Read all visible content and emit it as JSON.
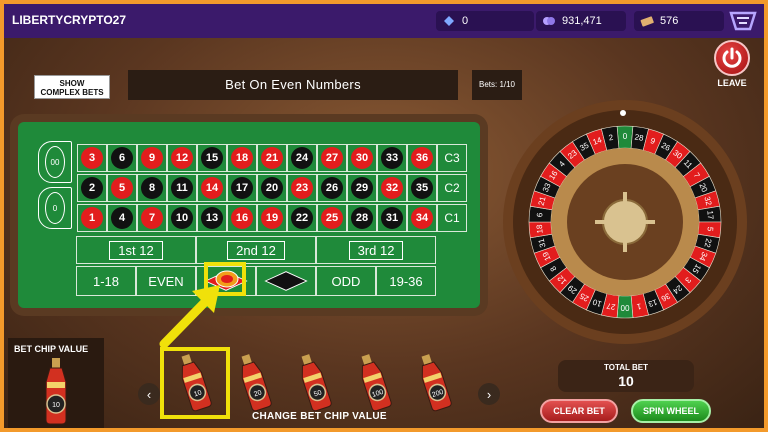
{
  "topbar": {
    "username": "LIBERTYCRYPTO27",
    "gems": "0",
    "coins": "931,471",
    "tickets": "576"
  },
  "controls": {
    "show_complex_label": "SHOW\nCOMPLEX BETS",
    "bet_title": "Bet On Even Numbers",
    "bets_count": "Bets: 1/10",
    "leave_label": "LEAVE"
  },
  "board": {
    "zeros": [
      "00",
      "0"
    ],
    "rows": [
      [
        {
          "n": "3",
          "c": "red"
        },
        {
          "n": "6",
          "c": "black"
        },
        {
          "n": "9",
          "c": "red"
        },
        {
          "n": "12",
          "c": "red"
        },
        {
          "n": "15",
          "c": "black"
        },
        {
          "n": "18",
          "c": "red"
        },
        {
          "n": "21",
          "c": "red"
        },
        {
          "n": "24",
          "c": "black"
        },
        {
          "n": "27",
          "c": "red"
        },
        {
          "n": "30",
          "c": "red"
        },
        {
          "n": "33",
          "c": "black"
        },
        {
          "n": "36",
          "c": "red"
        }
      ],
      [
        {
          "n": "2",
          "c": "black"
        },
        {
          "n": "5",
          "c": "red"
        },
        {
          "n": "8",
          "c": "black"
        },
        {
          "n": "11",
          "c": "black"
        },
        {
          "n": "14",
          "c": "red"
        },
        {
          "n": "17",
          "c": "black"
        },
        {
          "n": "20",
          "c": "black"
        },
        {
          "n": "23",
          "c": "red"
        },
        {
          "n": "26",
          "c": "black"
        },
        {
          "n": "29",
          "c": "black"
        },
        {
          "n": "32",
          "c": "red"
        },
        {
          "n": "35",
          "c": "black"
        }
      ],
      [
        {
          "n": "1",
          "c": "red"
        },
        {
          "n": "4",
          "c": "black"
        },
        {
          "n": "7",
          "c": "red"
        },
        {
          "n": "10",
          "c": "black"
        },
        {
          "n": "13",
          "c": "black"
        },
        {
          "n": "16",
          "c": "red"
        },
        {
          "n": "19",
          "c": "red"
        },
        {
          "n": "22",
          "c": "black"
        },
        {
          "n": "25",
          "c": "red"
        },
        {
          "n": "28",
          "c": "black"
        },
        {
          "n": "31",
          "c": "black"
        },
        {
          "n": "34",
          "c": "red"
        }
      ]
    ],
    "columns": [
      "C3",
      "C2",
      "C1"
    ],
    "dozens": [
      "1st 12",
      "2nd 12",
      "3rd 12"
    ],
    "outside": {
      "low": "1-18",
      "even": "EVEN",
      "odd": "ODD",
      "high": "19-36"
    },
    "colors": {
      "red": "#e21d1d",
      "black": "#111111",
      "felt": "#1f8a3a",
      "highlight": "#f0e10a"
    }
  },
  "chips": {
    "bet_chip_label": "BET CHIP VALUE",
    "current_value": "10",
    "options": [
      "10",
      "20",
      "50",
      "100",
      "200"
    ],
    "change_label": "CHANGE BET CHIP VALUE"
  },
  "footer": {
    "total_label": "TOTAL BET",
    "total_value": "10",
    "clear_label": "CLEAR BET",
    "spin_label": "SPIN WHEEL"
  },
  "wheel": {
    "sequence": [
      "0",
      "28",
      "9",
      "26",
      "30",
      "11",
      "7",
      "20",
      "32",
      "17",
      "5",
      "22",
      "34",
      "15",
      "3",
      "24",
      "36",
      "13",
      "1",
      "00",
      "27",
      "10",
      "25",
      "29",
      "12",
      "8",
      "19",
      "31",
      "18",
      "6",
      "21",
      "33",
      "16",
      "4",
      "23",
      "35",
      "14",
      "2"
    ]
  }
}
